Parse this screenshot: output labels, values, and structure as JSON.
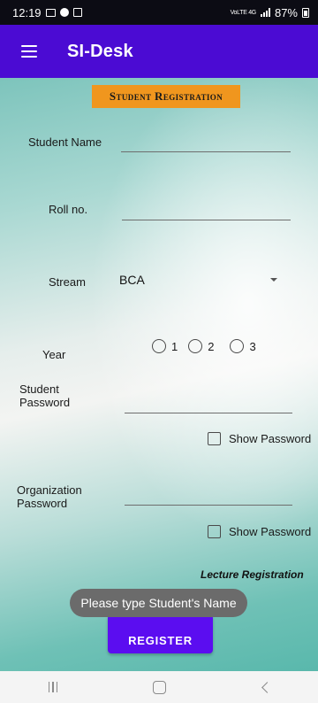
{
  "status_bar": {
    "time": "12:19",
    "network": "VoLTE 4G",
    "battery": "87%"
  },
  "app_bar": {
    "title": "SI-Desk",
    "menu_icon": "hamburger-menu-icon",
    "color": "#4b0bd3"
  },
  "form": {
    "banner": "Student Registration",
    "student_name": {
      "label": "Student Name",
      "value": ""
    },
    "roll_no": {
      "label": "Roll no.",
      "value": ""
    },
    "stream": {
      "label": "Stream",
      "selected": "BCA"
    },
    "year": {
      "label": "Year",
      "options": [
        "1",
        "2",
        "3"
      ]
    },
    "student_password": {
      "label_line1": "Student",
      "label_line2": "Password",
      "value": "",
      "show_label": "Show Password"
    },
    "org_password": {
      "label_line1": "Organization",
      "label_line2": "Password",
      "value": "",
      "show_label": "Show Password"
    },
    "lecture_link": "Lecture Registration",
    "register_label": "REGISTER"
  },
  "toast": "Please type Student's Name",
  "colors": {
    "banner": "#f0961e",
    "button": "#5b0df0"
  }
}
